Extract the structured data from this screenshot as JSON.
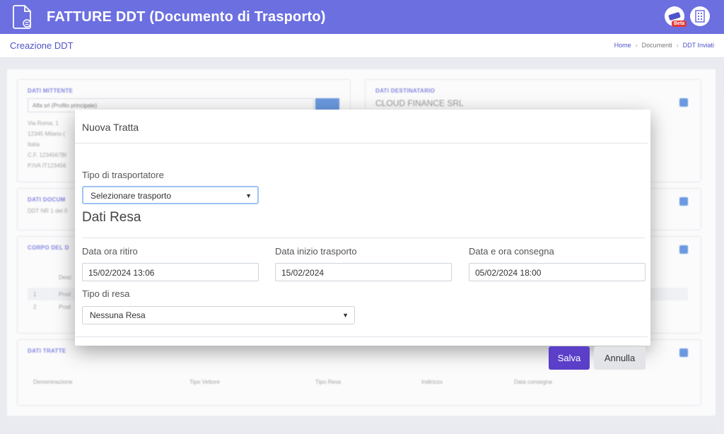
{
  "app": {
    "title": "FATTURE DDT (Documento di Trasporto)",
    "beta_label": "Beta"
  },
  "subheader": {
    "page_title": "Creazione DDT",
    "breadcrumb": [
      "Home",
      "Documenti",
      "DDT Inviati"
    ]
  },
  "background": {
    "mittente": {
      "caption": "DATI MITTENTE",
      "select_value": "Alfa srl (Profilo principale)",
      "address_lines": [
        "Via Roma, 1",
        "12345 Milano (",
        "Italia",
        "C.F. 1234567BI",
        "P.IVA IT123456"
      ]
    },
    "destinatario": {
      "caption": "DATI DESTINATARIO",
      "name": "CLOUD FINANCE SRL"
    },
    "documento": {
      "caption": "DATI DOCUM",
      "text": "DDT NR 1 del 0"
    },
    "corpo": {
      "caption": "CORPO DEL D",
      "header": "Desc",
      "rows": [
        [
          "1",
          "Prod"
        ],
        [
          "2",
          "Prod"
        ]
      ]
    },
    "tratte": {
      "caption": "DATI TRATTE",
      "columns": [
        "Denominazione",
        "Tipo Vettore",
        "Tipo Resa",
        "Indirizzo",
        "Data consegna"
      ]
    }
  },
  "modal": {
    "title": "Nuova Tratta",
    "tipo_trasportatore_label": "Tipo di trasportatore",
    "tipo_trasportatore_value": "Selezionare trasporto",
    "section_title": "Dati Resa",
    "data_ora_ritiro_label": "Data ora ritiro",
    "data_ora_ritiro_value": "15/02/2024 13:06",
    "data_inizio_label": "Data inizio trasporto",
    "data_inizio_value": "15/02/2024",
    "data_consegna_label": "Data e ora consegna",
    "data_consegna_value": "05/02/2024 18:00",
    "tipo_resa_label": "Tipo di resa",
    "tipo_resa_value": "Nessuna Resa",
    "save_label": "Salva",
    "cancel_label": "Annulla"
  }
}
